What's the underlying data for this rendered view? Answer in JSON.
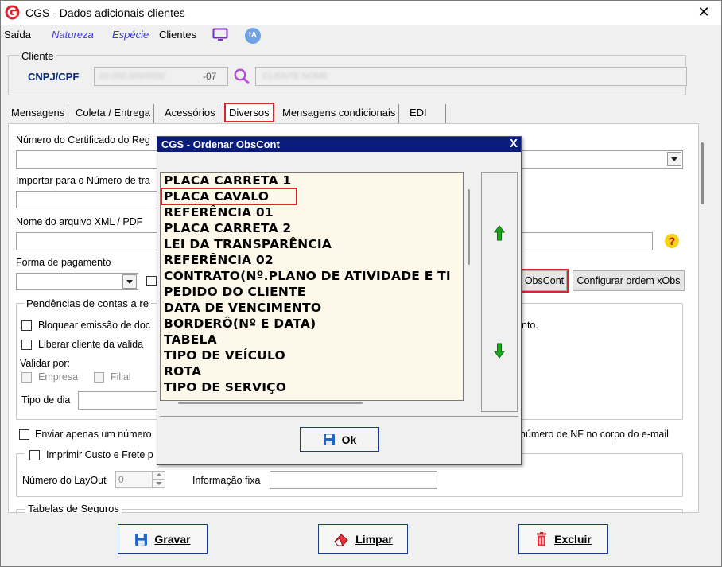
{
  "window": {
    "title": "CGS - Dados adicionais clientes",
    "close_glyph": "✕",
    "app_icon": "cgs-logo-icon"
  },
  "menu": {
    "items": [
      "Saída",
      "Natureza",
      "Espécie",
      "Clientes"
    ],
    "monitor_icon": "monitor-icon",
    "ia_label": "IA"
  },
  "cliente": {
    "group_label": "Cliente",
    "cnpj_label": "CNPJ/CPF",
    "cnpj_value_visible": "-07",
    "search_icon": "search-icon"
  },
  "tabs": [
    "Mensagens",
    "Coleta / Entrega",
    "Acessórios",
    "Diversos",
    "Mensagens condicionais",
    "EDI"
  ],
  "active_tab": "Diversos",
  "diversos": {
    "certificado_label": "Número do Certificado do Reg",
    "importar_label": "Importar para o Número de tra",
    "xml_label": "Nome do arquivo XML / PDF",
    "forma_label": "Forma de pagamento",
    "obscont_button": "ObsCont",
    "config_xobs_button": "Configurar ordem xObs",
    "pendencias_label": "Pendências de contas a re",
    "bloquear_label": "Bloquear emissão de doc",
    "bloquear_tail": "nto.",
    "liberar_label": "Liberar cliente da valida",
    "validar_label": "Validar por:",
    "empresa_label": "Empresa",
    "filial_label": "Filial",
    "tipo_dia_label": "Tipo de dia",
    "enviar_label": "Enviar apenas um número",
    "enviar_tail": "número de NF no corpo do e-mail",
    "imprimir_label": "Imprimir Custo e Frete p",
    "layout_label": "Número do LayOut",
    "layout_value": "0",
    "info_fixa_label": "Informação fixa",
    "tabelas_label": "Tabelas de Seguros",
    "help_icon": "question-icon"
  },
  "dialog": {
    "title": "CGS - Ordenar ObsCont",
    "close_glyph": "X",
    "items": [
      "PLACA CARRETA 1",
      "PLACA CAVALO",
      "REFERÊNCIA 01",
      "PLACA CARRETA 2",
      "LEI DA TRANSPARÊNCIA",
      "REFERÊNCIA 02",
      "CONTRATO(Nº.PLANO DE ATIVIDADE E TI",
      "PEDIDO DO CLIENTE",
      "DATA DE VENCIMENTO",
      "BORDERÔ(Nº E DATA)",
      "TABELA",
      "TIPO DE VEÍCULO",
      "ROTA",
      "TIPO DE SERVIÇO"
    ],
    "highlighted_item": "PLACA CAVALO",
    "move_up_icon": "arrow-up-icon",
    "move_down_icon": "arrow-down-icon",
    "ok_button": "Ok"
  },
  "actions": {
    "gravar": "Gravar",
    "limpar": "Limpar",
    "excluir": "Excluir"
  },
  "colors": {
    "accent_blue": "#0a1c7a",
    "highlight_red": "#d9262b",
    "list_background": "#fdf8ea",
    "arrow_green": "#1ea51e"
  }
}
